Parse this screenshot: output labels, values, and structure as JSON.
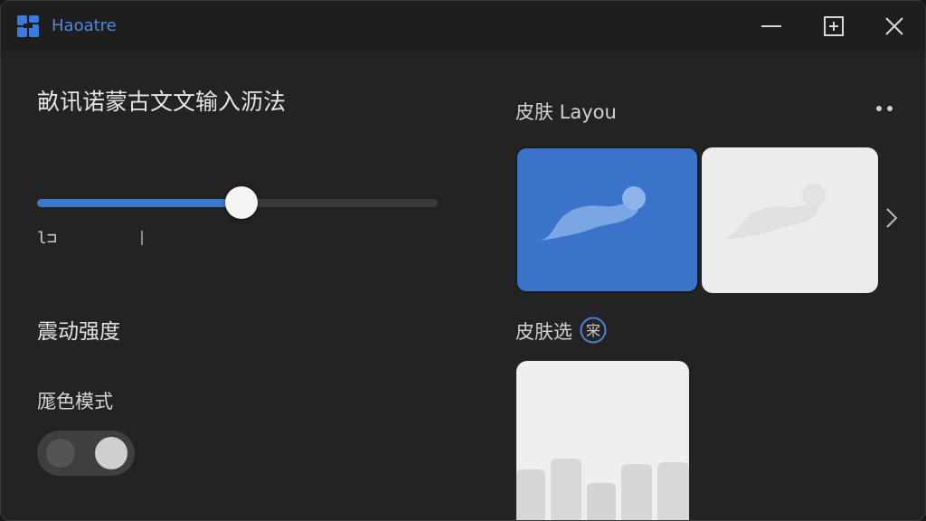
{
  "window": {
    "title": "Haoatre",
    "controls": {
      "minimize": "minimize-icon",
      "maximize": "maximize-icon",
      "close": "close-icon"
    }
  },
  "left_panel": {
    "title": "畝讯诺蒙古文文输入沥法",
    "slider": {
      "value_fraction": 0.51,
      "min_label": "l⊐"
    },
    "vibration_label": "震动强度",
    "dark_mode_label": "厖色模式",
    "dark_mode_toggle_on": true
  },
  "right_panel": {
    "skin_layout_label": "皮肤 Layou",
    "skin_select_label": "皮肤选",
    "skin_select_badge": "宩",
    "cards": [
      "blue-theme",
      "white-theme",
      "city-theme"
    ]
  },
  "colors": {
    "accent": "#3d78cd",
    "title_blue": "#4a8ae0",
    "background": "#232323"
  }
}
